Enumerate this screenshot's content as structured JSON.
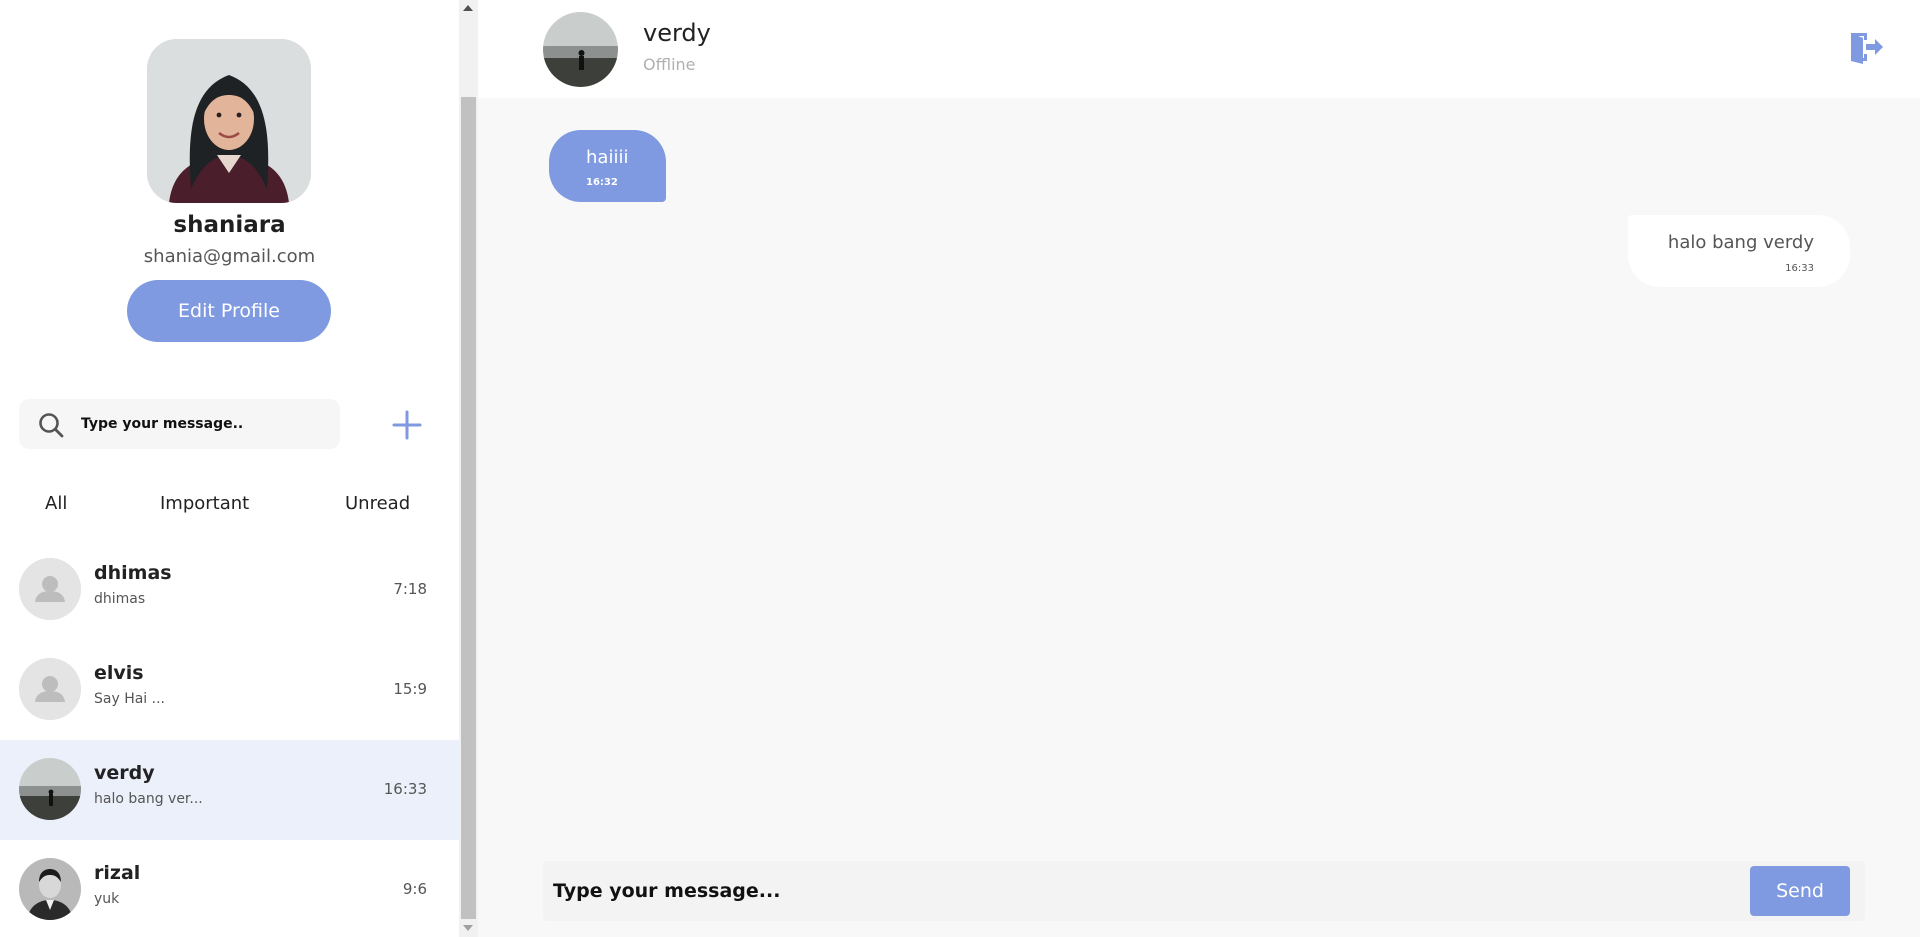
{
  "profile": {
    "name": "shaniara",
    "email": "shania@gmail.com",
    "edit_label": "Edit Profile"
  },
  "search": {
    "placeholder": "Type your message..",
    "icon": "search-icon",
    "add_icon": "plus-icon"
  },
  "filters": [
    "All",
    "Important",
    "Unread"
  ],
  "contacts": [
    {
      "name": "dhimas",
      "preview": "dhimas",
      "time": "7:18",
      "avatar": "default-user-icon",
      "active": false
    },
    {
      "name": "elvis",
      "preview": "Say Hai ...",
      "time": "15:9",
      "avatar": "default-user-icon",
      "active": false
    },
    {
      "name": "verdy",
      "preview": "halo bang ver...",
      "time": "16:33",
      "avatar": "photo",
      "active": true
    },
    {
      "name": "rizal",
      "preview": "yuk",
      "time": "9:6",
      "avatar": "photo",
      "active": false
    }
  ],
  "chat": {
    "name": "verdy",
    "status": "Offline",
    "logout_icon": "logout-icon",
    "messages": [
      {
        "direction": "incoming",
        "text": "haiiii",
        "time": "16:32"
      },
      {
        "direction": "outgoing",
        "text": "halo bang verdy",
        "time": "16:33"
      }
    ],
    "composer_placeholder": "Type your message...",
    "send_label": "Send"
  },
  "colors": {
    "accent": "#7f9ae0",
    "active_row": "#ecf0fb",
    "chat_bg": "#f8f8f8",
    "status_gray": "#b0b0b0"
  }
}
